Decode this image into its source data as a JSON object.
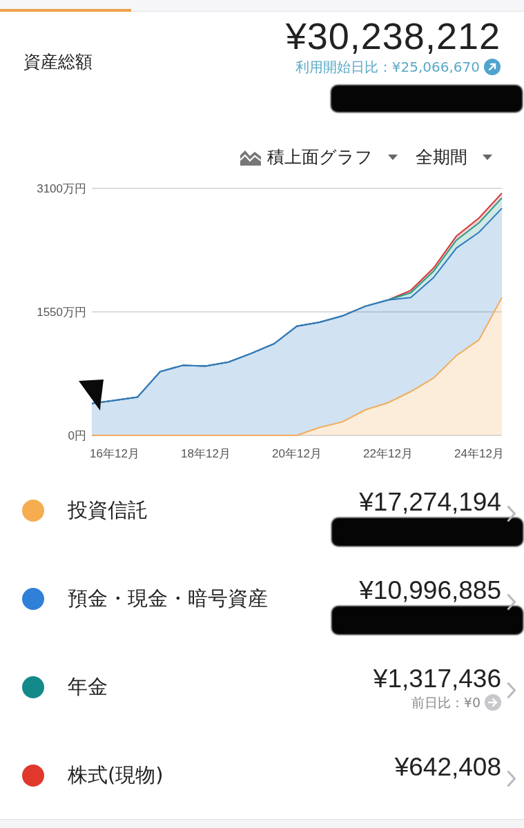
{
  "summary": {
    "label": "資産総額",
    "total": "¥30,238,212",
    "compare": {
      "text": "利用開始日比：¥25,066,670",
      "kind": "up"
    },
    "redacted": true
  },
  "chart_controls": [
    {
      "label": "積上面グラフ",
      "kind": "chart-type"
    },
    {
      "label": "全期間",
      "kind": "period"
    }
  ],
  "chart": {
    "redacted": true,
    "chart_data": {
      "type": "area",
      "stacked": true,
      "categories": [
        null,
        "16年12月",
        null,
        null,
        null,
        "18年12月",
        null,
        null,
        null,
        "20年12月",
        null,
        null,
        null,
        "22年12月",
        null,
        null,
        null,
        "24年12月",
        null
      ],
      "series": [
        {
          "color": "#f0ad5a",
          "values": [
            0,
            0,
            0,
            0,
            0,
            0,
            0,
            0,
            0,
            0,
            100,
            170,
            320,
            410,
            550,
            720,
            1000,
            1200,
            1730
          ]
        },
        {
          "color": "#2f7cc4",
          "values": [
            400,
            440,
            480,
            800,
            880,
            870,
            920,
            1030,
            1150,
            1370,
            1320,
            1330,
            1300,
            1290,
            1180,
            1260,
            1350,
            1350,
            1120
          ]
        },
        {
          "color": "#2a9a86",
          "values": [
            0,
            0,
            0,
            0,
            0,
            0,
            0,
            0,
            0,
            0,
            0,
            0,
            0,
            0,
            60,
            80,
            100,
            120,
            130
          ]
        },
        {
          "color": "#d2383a",
          "values": [
            0,
            0,
            0,
            0,
            0,
            0,
            0,
            0,
            0,
            0,
            0,
            0,
            0,
            0,
            30,
            40,
            50,
            60,
            60
          ]
        }
      ],
      "ylim": [
        0,
        3100
      ],
      "yticks": [
        {
          "value": 0,
          "label": "0円"
        },
        {
          "value": 1550,
          "label": "1550万円"
        },
        {
          "value": 3100,
          "label": "3100万円"
        }
      ]
    }
  },
  "assets": [
    {
      "name": "投資信託",
      "color": "#f5ad4f",
      "amount": "¥17,274,194",
      "redacted": true
    },
    {
      "name": "預金・現金・暗号資産",
      "color": "#2f80d8",
      "amount": "¥10,996,885",
      "redacted": true
    },
    {
      "name": "年金",
      "color": "#14898a",
      "amount": "¥1,317,436",
      "compare": {
        "text": "前日比：¥0",
        "kind": "flat"
      },
      "redacted": false
    },
    {
      "name": "株式(現物)",
      "color": "#e0392b",
      "amount": "¥642,408",
      "redacted": false
    }
  ]
}
